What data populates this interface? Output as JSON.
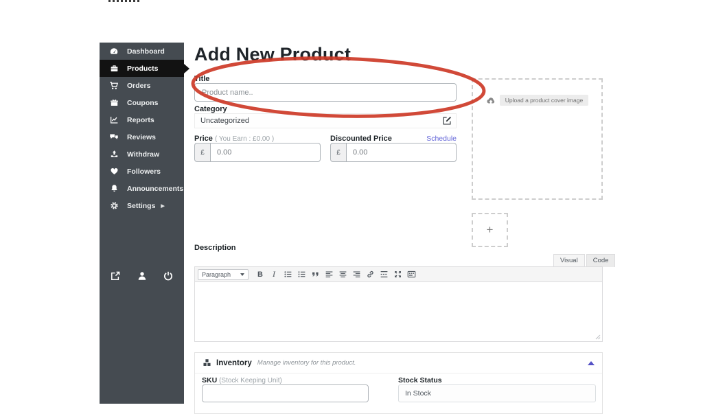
{
  "page": {
    "title": "Add New Product"
  },
  "colors": {
    "sidebar_bg": "#454b51",
    "sidebar_active_bg": "#121212",
    "accent_link": "#6264d8",
    "annotation_red": "#cd3a27"
  },
  "sidebar": {
    "items": [
      {
        "label": "Dashboard",
        "icon": "dashboard-icon",
        "active": false
      },
      {
        "label": "Products",
        "icon": "products-icon",
        "active": true
      },
      {
        "label": "Orders",
        "icon": "cart-icon",
        "active": false
      },
      {
        "label": "Coupons",
        "icon": "gift-icon",
        "active": false
      },
      {
        "label": "Reports",
        "icon": "chart-icon",
        "active": false
      },
      {
        "label": "Reviews",
        "icon": "comments-icon",
        "active": false
      },
      {
        "label": "Withdraw",
        "icon": "upload-icon",
        "active": false
      },
      {
        "label": "Followers",
        "icon": "heart-icon",
        "active": false
      },
      {
        "label": "Announcements",
        "icon": "bell-icon",
        "active": false
      },
      {
        "label": "Settings",
        "icon": "gear-icon",
        "active": false,
        "has_submenu": true
      }
    ],
    "footer_icons": [
      "external-link-icon",
      "user-icon",
      "power-icon"
    ]
  },
  "form": {
    "title": {
      "label": "Title",
      "placeholder": "Product name.."
    },
    "category": {
      "label": "Category",
      "value": "Uncategorized",
      "edit_icon": "edit-icon"
    },
    "price": {
      "label": "Price",
      "hint": "( You Earn : £0.00 )",
      "currency": "£",
      "placeholder": "0.00"
    },
    "discounted_price": {
      "label": "Discounted Price",
      "schedule_label": "Schedule",
      "currency": "£",
      "placeholder": "0.00"
    },
    "cover": {
      "upload_label": "Upload a product cover image",
      "upload_icon": "cloud-upload-icon",
      "add_more_label": "+"
    },
    "description": {
      "label": "Description",
      "tabs": [
        {
          "label": "Visual",
          "active": true
        },
        {
          "label": "Code",
          "active": false
        }
      ],
      "paragraph_dropdown": "Paragraph",
      "toolbar_icons": [
        "bold-icon",
        "italic-icon",
        "bullet-list-icon",
        "ordered-list-icon",
        "blockquote-icon",
        "align-left-icon",
        "align-center-icon",
        "align-right-icon",
        "link-icon",
        "read-more-icon",
        "fullscreen-icon",
        "toolbar-toggle-icon"
      ]
    },
    "inventory": {
      "title": "Inventory",
      "subtitle": "Manage inventory for this product.",
      "icon": "cubes-icon",
      "sku_label": "SKU",
      "sku_hint": "(Stock Keeping Unit)",
      "sku_value": "",
      "stock_status_label": "Stock Status",
      "stock_status_value": "In Stock"
    }
  }
}
